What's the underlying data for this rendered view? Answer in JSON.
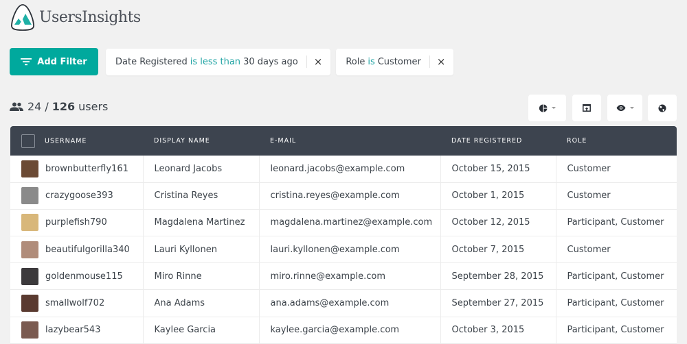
{
  "app": {
    "title": "UsersInsights"
  },
  "filters": {
    "add_label": "Add Filter",
    "items": [
      {
        "field": "Date Registered",
        "operator": "is less than",
        "value": "30 days ago"
      },
      {
        "field": "Role",
        "operator": "is",
        "value": "Customer"
      }
    ],
    "remove_icon": "×"
  },
  "summary": {
    "shown": "24",
    "separator": "/",
    "total": "126",
    "unit": "users"
  },
  "toolbar": {
    "buttons": [
      {
        "icon": "pie-chart-icon",
        "has_dropdown": true
      },
      {
        "icon": "export-icon",
        "has_dropdown": false
      },
      {
        "icon": "eye-icon",
        "has_dropdown": true
      },
      {
        "icon": "globe-icon",
        "has_dropdown": false
      }
    ]
  },
  "table": {
    "columns": [
      "USERNAME",
      "DISPLAY NAME",
      "E-MAIL",
      "DATE REGISTERED",
      "ROLE"
    ],
    "rows": [
      {
        "username": "brownbutterfly161",
        "display_name": "Leonard Jacobs",
        "email": "leonard.jacobs@example.com",
        "date": "October 15, 2015",
        "role": "Customer",
        "avatar_color": "#6b4a34"
      },
      {
        "username": "crazygoose393",
        "display_name": "Cristina Reyes",
        "email": "cristina.reyes@example.com",
        "date": "October 1, 2015",
        "role": "Customer",
        "avatar_color": "#8a8a8a"
      },
      {
        "username": "purplefish790",
        "display_name": "Magdalena Martinez",
        "email": "magdalena.martinez@example.com",
        "date": "October 12, 2015",
        "role": "Participant, Customer",
        "avatar_color": "#d8b77a"
      },
      {
        "username": "beautifulgorilla340",
        "display_name": "Lauri Kyllonen",
        "email": "lauri.kyllonen@example.com",
        "date": "October 7, 2015",
        "role": "Customer",
        "avatar_color": "#b08c7a"
      },
      {
        "username": "goldenmouse115",
        "display_name": "Miro Rinne",
        "email": "miro.rinne@example.com",
        "date": "September 28, 2015",
        "role": "Participant, Customer",
        "avatar_color": "#3c3a3c"
      },
      {
        "username": "smallwolf702",
        "display_name": "Ana Adams",
        "email": "ana.adams@example.com",
        "date": "September 27, 2015",
        "role": "Participant, Customer",
        "avatar_color": "#5a3a30"
      },
      {
        "username": "lazybear543",
        "display_name": "Kaylee Garcia",
        "email": "kaylee.garcia@example.com",
        "date": "October 3, 2015",
        "role": "Participant, Customer",
        "avatar_color": "#7a5a50"
      }
    ]
  },
  "colors": {
    "accent": "#00a99d",
    "header_bg": "#3d444f",
    "operator_text": "#1fa3a3"
  }
}
